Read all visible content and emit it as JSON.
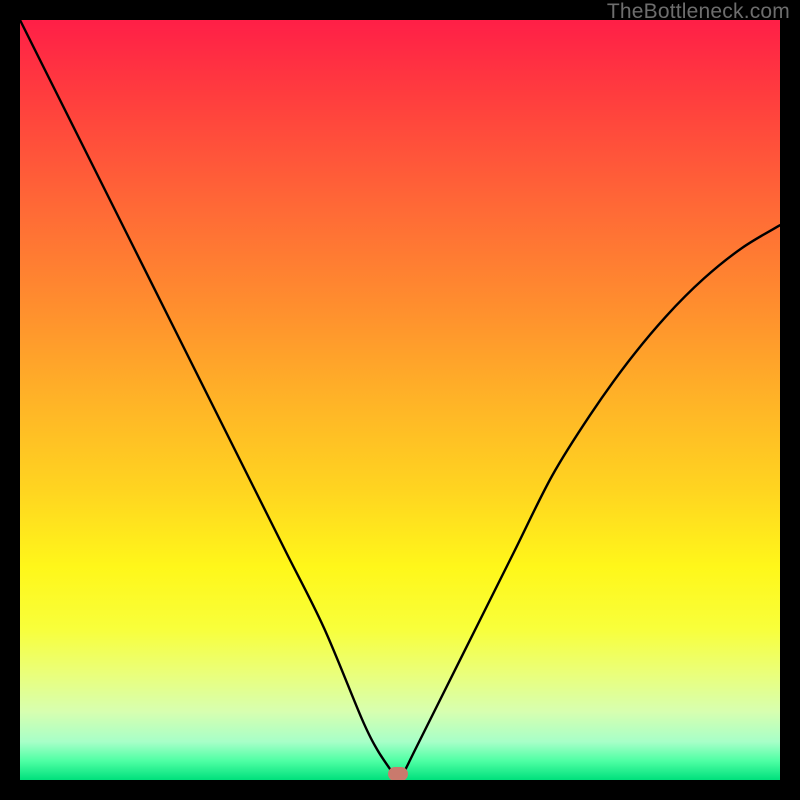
{
  "watermark": "TheBottleneck.com",
  "marker": {
    "x_frac": 0.497,
    "y_frac": 0.992
  },
  "chart_data": {
    "type": "line",
    "title": "",
    "xlabel": "",
    "ylabel": "",
    "xlim": [
      0,
      100
    ],
    "ylim": [
      0,
      100
    ],
    "series": [
      {
        "name": "bottleneck-curve",
        "x": [
          0,
          5,
          10,
          15,
          20,
          25,
          30,
          35,
          40,
          45,
          47,
          49,
          49.7,
          50.5,
          52,
          55,
          60,
          65,
          70,
          75,
          80,
          85,
          90,
          95,
          100
        ],
        "y": [
          100,
          90,
          80,
          70,
          60,
          50,
          40,
          30,
          20,
          8,
          4,
          1,
          0,
          1,
          4,
          10,
          20,
          30,
          40,
          48,
          55,
          61,
          66,
          70,
          73
        ]
      }
    ],
    "annotations": [
      {
        "type": "marker",
        "x": 49.7,
        "y": 0.8,
        "label": "optimal-point"
      }
    ],
    "background_gradient": {
      "direction": "top-to-bottom",
      "stops": [
        {
          "pos": 0.0,
          "color": "#ff1f47"
        },
        {
          "pos": 0.5,
          "color": "#ffb327"
        },
        {
          "pos": 0.8,
          "color": "#f8ff3a"
        },
        {
          "pos": 1.0,
          "color": "#00e07c"
        }
      ]
    }
  }
}
